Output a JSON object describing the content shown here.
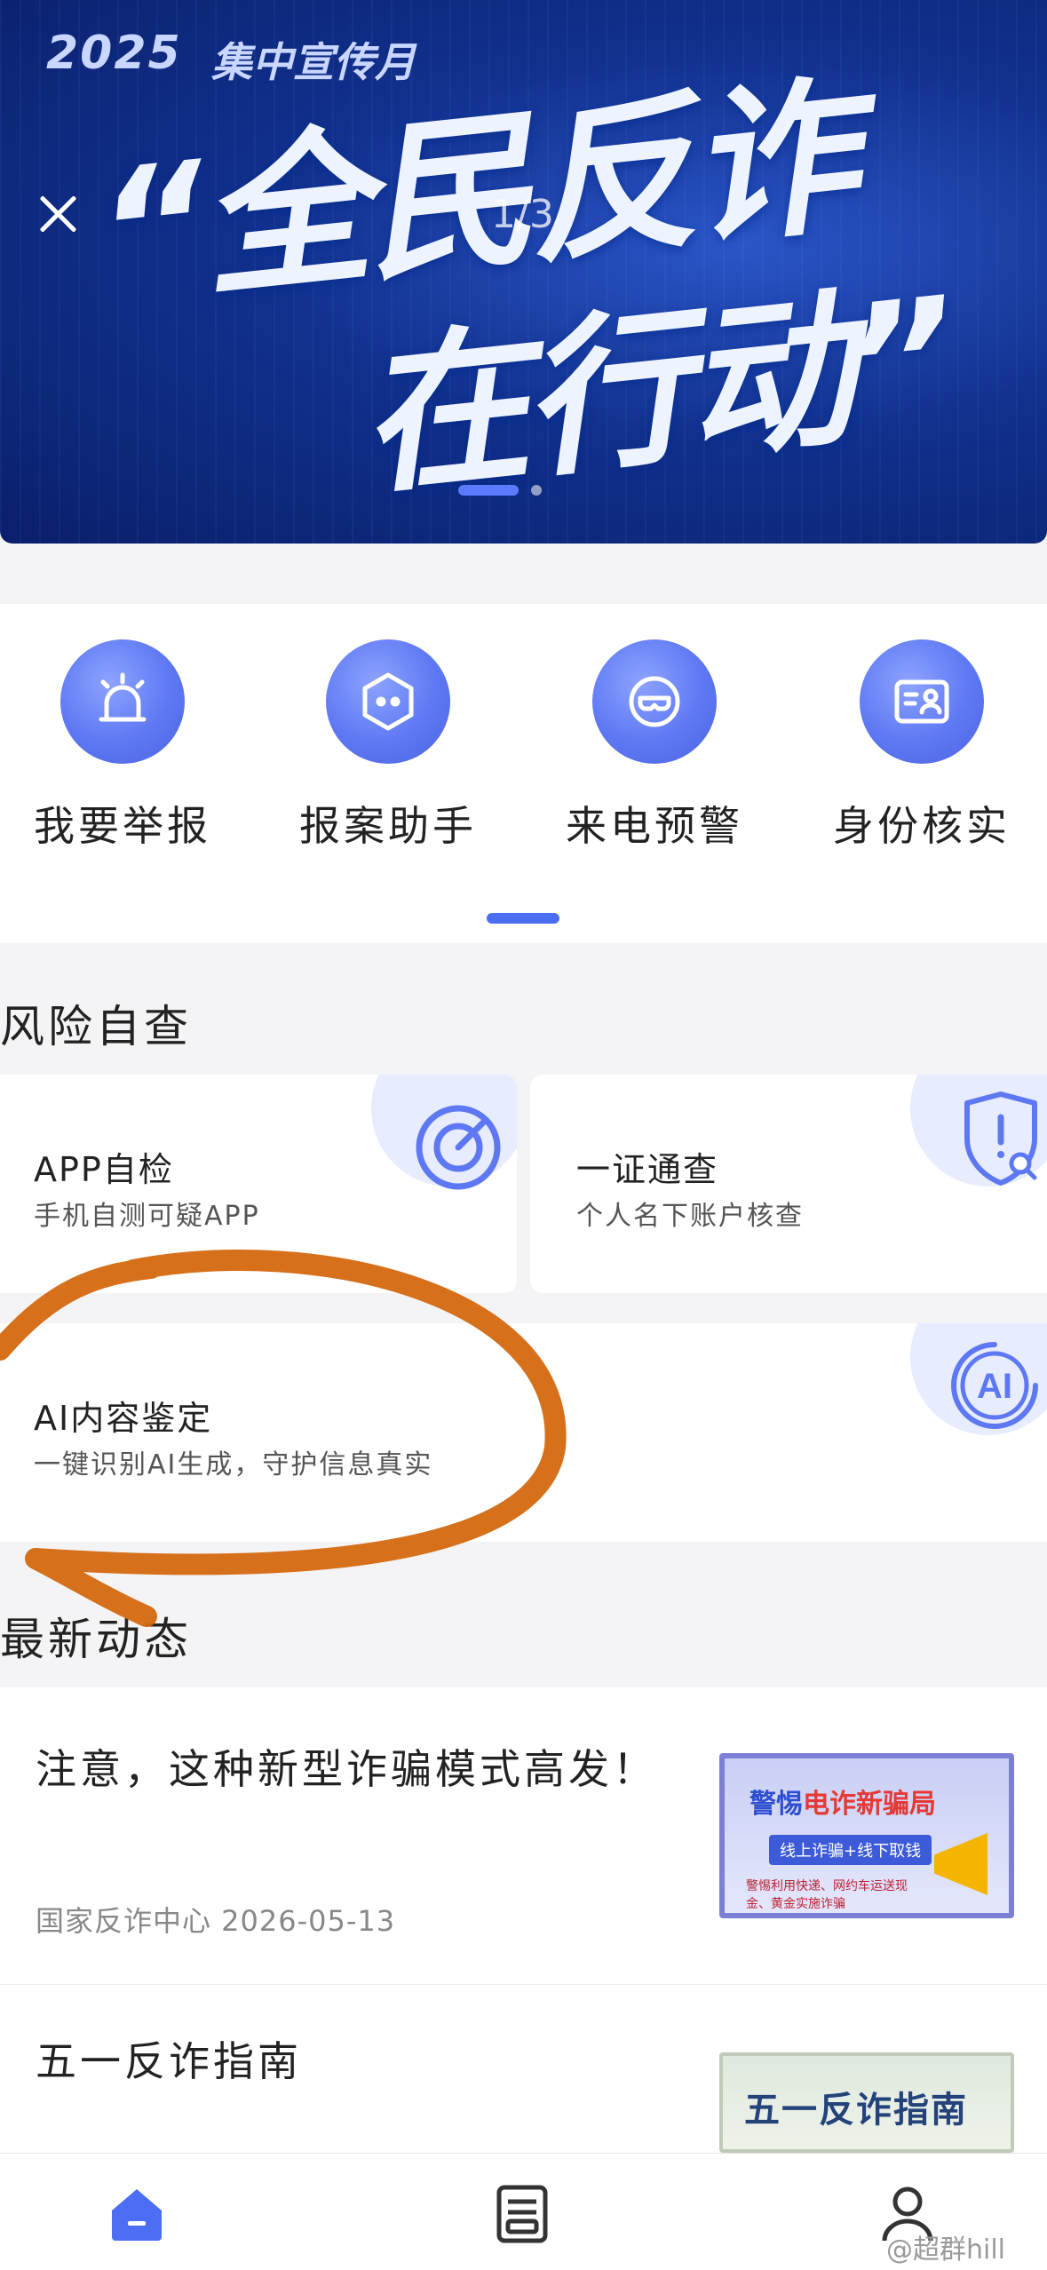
{
  "banner": {
    "year": "2025",
    "subtitle": "集中宣传月",
    "headline_line1": "“全民反诈",
    "headline_line2": "在行动”",
    "page_counter": "1/3"
  },
  "quick_actions": [
    {
      "label": "我要举报",
      "icon": "alarm-light-icon"
    },
    {
      "label": "报案助手",
      "icon": "robot-hexagon-icon"
    },
    {
      "label": "来电预警",
      "icon": "mask-icon"
    },
    {
      "label": "身份核实",
      "icon": "id-card-icon"
    }
  ],
  "risk_check": {
    "section_title": "风险自查",
    "cards": [
      {
        "title": "APP自检",
        "desc": "手机自测可疑APP",
        "icon": "target-scan-icon"
      },
      {
        "title": "一证通查",
        "desc": "个人名下账户核查",
        "icon": "shield-search-icon"
      },
      {
        "title": "AI内容鉴定",
        "desc": "一键识别AI生成，守护信息真实",
        "icon": "ai-icon",
        "icon_text": "AI"
      }
    ]
  },
  "news": {
    "section_title": "最新动态",
    "items": [
      {
        "title": "注意，这种新型诈骗模式高发！",
        "meta": "国家反诈中心  2026-05-13",
        "thumb_head_prefix": "警惕",
        "thumb_head_highlight": "电诈新骗局",
        "thumb_pill": "线上诈骗+线下取钱",
        "thumb_small": "警惕利用快递、网约车运送现金、黄金实施诈骗"
      },
      {
        "title": "五一反诈指南",
        "thumb_text": "五一反诈指南"
      }
    ]
  },
  "tabbar": {
    "tabs": [
      {
        "icon": "home-icon",
        "active": true
      },
      {
        "icon": "document-icon",
        "active": false
      },
      {
        "icon": "user-icon",
        "active": false
      }
    ]
  },
  "watermark": "@超群hill",
  "colors": {
    "accent": "#4c6ef5",
    "banner_bg": "#11318e",
    "annotation": "#d4680f"
  }
}
